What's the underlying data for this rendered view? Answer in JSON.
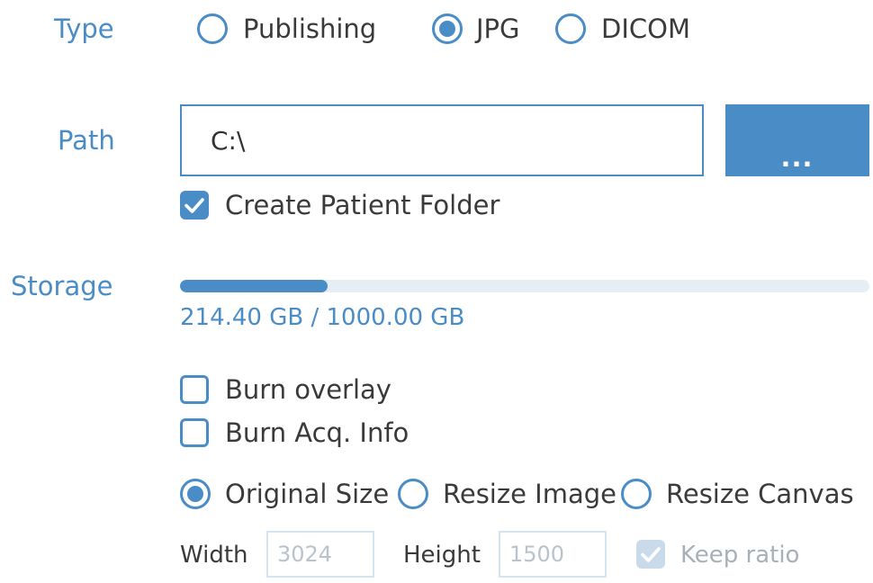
{
  "colors": {
    "accent": "#4a8cc6",
    "label": "#4a8cc6",
    "text": "#3a3a3a",
    "disabled": "#b8c3cc"
  },
  "type": {
    "label": "Type",
    "options": [
      {
        "label": "Publishing",
        "selected": false
      },
      {
        "label": "JPG",
        "selected": true
      },
      {
        "label": "DICOM",
        "selected": false
      }
    ]
  },
  "path": {
    "label": "Path",
    "value": "C:\\",
    "browse_label": "...",
    "create_folder_label": "Create Patient Folder",
    "create_folder_checked": true
  },
  "storage": {
    "label": "Storage",
    "text": "214.40 GB / 1000.00 GB",
    "used_fraction": 0.2144
  },
  "burn": {
    "overlay_label": "Burn overlay",
    "overlay_checked": false,
    "acq_label": "Burn Acq. Info",
    "acq_checked": false
  },
  "size": {
    "options": [
      {
        "label": "Original Size",
        "selected": true
      },
      {
        "label": "Resize Image",
        "selected": false
      },
      {
        "label": "Resize Canvas",
        "selected": false
      }
    ],
    "width_label": "Width",
    "width_value": "3024",
    "height_label": "Height",
    "height_value": "1500",
    "keep_ratio_label": "Keep ratio",
    "keep_ratio_checked": true
  }
}
